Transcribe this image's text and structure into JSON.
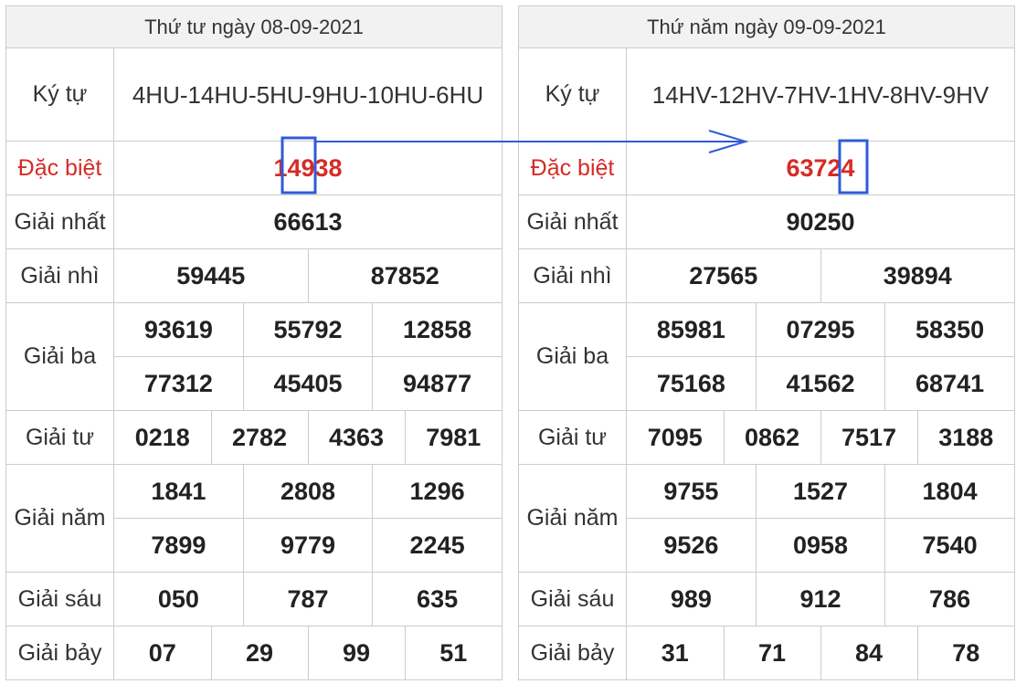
{
  "row_labels": {
    "code": "Ký tự",
    "special": "Đặc biệt",
    "first": "Giải nhất",
    "second": "Giải nhì",
    "third": "Giải ba",
    "fourth": "Giải tư",
    "fifth": "Giải năm",
    "sixth": "Giải sáu",
    "seventh": "Giải bảy"
  },
  "left": {
    "date": "Thứ tư ngày 08-09-2021",
    "code": "4HU-14HU-5HU-9HU-10HU-6HU",
    "special": "14938",
    "first": "66613",
    "second": [
      "59445",
      "87852"
    ],
    "third": [
      "93619",
      "55792",
      "12858",
      "77312",
      "45405",
      "94877"
    ],
    "fourth": [
      "0218",
      "2782",
      "4363",
      "7981"
    ],
    "fifth": [
      "1841",
      "2808",
      "1296",
      "7899",
      "9779",
      "2245"
    ],
    "sixth": [
      "050",
      "787",
      "635"
    ],
    "seventh": [
      "07",
      "29",
      "99",
      "51"
    ]
  },
  "right": {
    "date": "Thứ năm ngày 09-09-2021",
    "code": "14HV-12HV-7HV-1HV-8HV-9HV",
    "special": "63724",
    "first": "90250",
    "second": [
      "27565",
      "39894"
    ],
    "third": [
      "85981",
      "07295",
      "58350",
      "75168",
      "41562",
      "68741"
    ],
    "fourth": [
      "7095",
      "0862",
      "7517",
      "3188"
    ],
    "fifth": [
      "9755",
      "1527",
      "1804",
      "9526",
      "0958",
      "7540"
    ],
    "sixth": [
      "989",
      "912",
      "786"
    ],
    "seventh": [
      "31",
      "71",
      "84",
      "78"
    ]
  },
  "annotation": {
    "color": "#2f5bd9"
  }
}
